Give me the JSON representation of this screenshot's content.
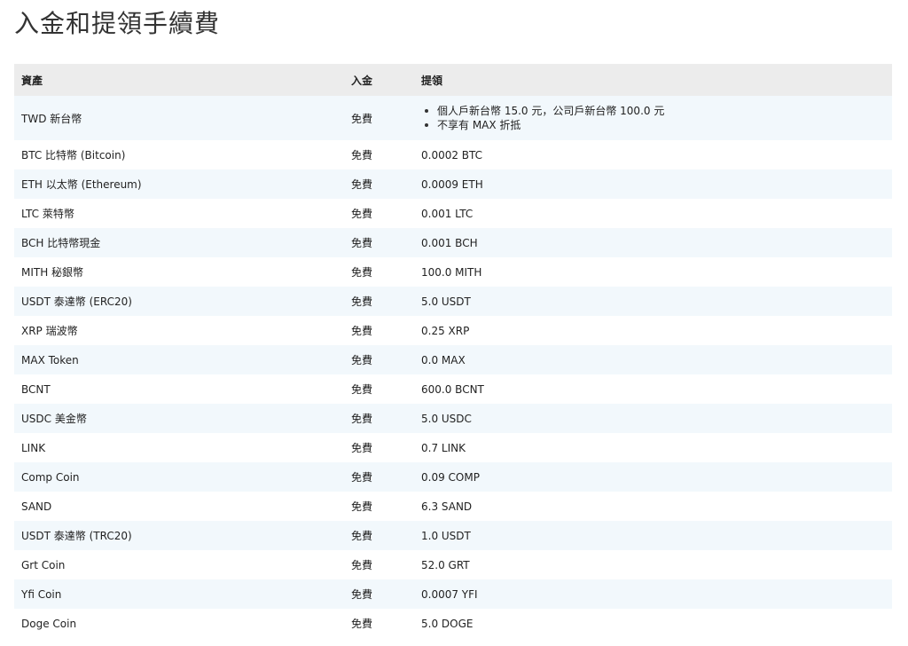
{
  "page": {
    "title": "入金和提領手續費"
  },
  "table": {
    "headers": {
      "asset": "資產",
      "deposit": "入金",
      "withdraw": "提領"
    },
    "twd": {
      "asset": "TWD 新台幣",
      "deposit": "免費",
      "withdraw_notes": [
        "個人戶新台幣 15.0 元，公司戶新台幣 100.0 元",
        "不享有 MAX 折抵"
      ]
    },
    "rows": [
      {
        "asset": "BTC 比特幣 (Bitcoin)",
        "deposit": "免費",
        "withdraw": "0.0002 BTC"
      },
      {
        "asset": "ETH 以太幣 (Ethereum)",
        "deposit": "免費",
        "withdraw": "0.0009 ETH"
      },
      {
        "asset": "LTC 萊特幣",
        "deposit": "免費",
        "withdraw": "0.001 LTC"
      },
      {
        "asset": "BCH 比特幣現金",
        "deposit": "免費",
        "withdraw": "0.001 BCH"
      },
      {
        "asset": "MITH 秘銀幣",
        "deposit": "免費",
        "withdraw": "100.0 MITH"
      },
      {
        "asset": "USDT 泰達幣 (ERC20)",
        "deposit": "免費",
        "withdraw": "5.0 USDT"
      },
      {
        "asset": "XRP 瑞波幣",
        "deposit": "免費",
        "withdraw": "0.25 XRP"
      },
      {
        "asset": "MAX Token",
        "deposit": "免費",
        "withdraw": "0.0 MAX"
      },
      {
        "asset": "BCNT",
        "deposit": "免費",
        "withdraw": "600.0 BCNT"
      },
      {
        "asset": "USDC 美金幣",
        "deposit": "免費",
        "withdraw": "5.0 USDC"
      },
      {
        "asset": "LINK",
        "deposit": "免費",
        "withdraw": "0.7 LINK"
      },
      {
        "asset": "Comp Coin",
        "deposit": "免費",
        "withdraw": "0.09 COMP"
      },
      {
        "asset": "SAND",
        "deposit": "免費",
        "withdraw": "6.3 SAND"
      },
      {
        "asset": "USDT 泰達幣 (TRC20)",
        "deposit": "免費",
        "withdraw": "1.0 USDT"
      },
      {
        "asset": "Grt Coin",
        "deposit": "免費",
        "withdraw": "52.0 GRT"
      },
      {
        "asset": "Yfi Coin",
        "deposit": "免費",
        "withdraw": "0.0007 YFI"
      },
      {
        "asset": "Doge Coin",
        "deposit": "免費",
        "withdraw": "5.0 DOGE"
      }
    ]
  },
  "colors": {
    "header_bg": "#ececec",
    "stripe_bg": "#f2f8fc",
    "text": "#222222"
  }
}
